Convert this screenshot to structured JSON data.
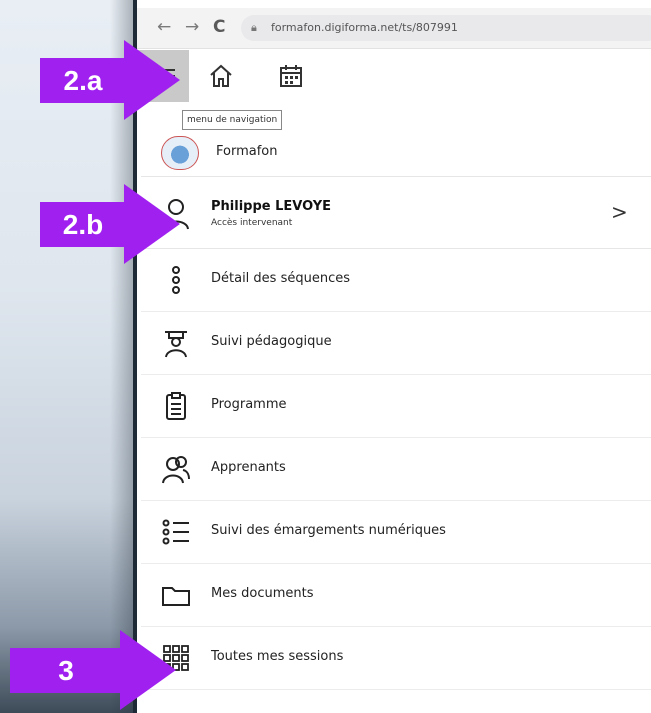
{
  "browser": {
    "back_icon": "arrow-left-icon",
    "forward_icon": "arrow-right-icon",
    "reload_icon": "reload-icon",
    "url": "formafon.digiforma.net/ts/807991"
  },
  "toolbar": {
    "tooltip": "menu de navigation"
  },
  "menu": {
    "brand": "Formafon",
    "user": {
      "name": "Philippe LEVOYE",
      "role": "Accès intervenant"
    },
    "items": [
      {
        "label": "Détail des séquences",
        "icon": "sequence-nodes-icon"
      },
      {
        "label": "Suivi pédagogique",
        "icon": "teacher-icon"
      },
      {
        "label": "Programme",
        "icon": "clipboard-icon"
      },
      {
        "label": "Apprenants",
        "icon": "users-icon"
      },
      {
        "label": "Suivi des émargements numériques",
        "icon": "checklist-icon"
      },
      {
        "label": "Mes documents",
        "icon": "folder-icon"
      },
      {
        "label": "Toutes mes sessions",
        "icon": "grid-icon"
      }
    ]
  },
  "annotations": {
    "a": "2.a",
    "b": "2.b",
    "c": "3"
  },
  "colors": {
    "annotation": "#a020f0"
  }
}
